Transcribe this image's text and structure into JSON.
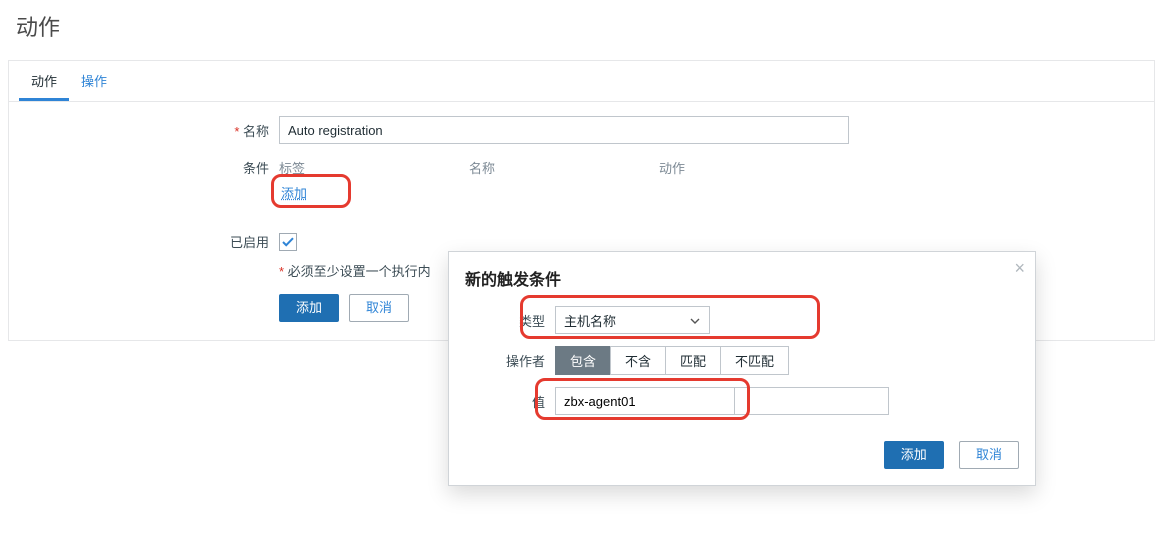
{
  "page": {
    "title": "动作"
  },
  "tabs": {
    "action": "动作",
    "operation": "操作"
  },
  "form": {
    "name_label": "名称",
    "name_value": "Auto registration",
    "condition_label": "条件",
    "cond_cols": {
      "tag": "标签",
      "name": "名称",
      "action": "动作"
    },
    "add_link": "添加",
    "enabled_label": "已启用",
    "note": "必须至少设置一个执行内",
    "add_btn": "添加",
    "cancel_btn": "取消"
  },
  "modal": {
    "title": "新的触发条件",
    "type_label": "类型",
    "type_value": "主机名称",
    "operator_label": "操作者",
    "operators": [
      "包含",
      "不含",
      "匹配",
      "不匹配"
    ],
    "value_label": "值",
    "value_value": "zbx-agent01",
    "add_btn": "添加",
    "cancel_btn": "取消"
  }
}
